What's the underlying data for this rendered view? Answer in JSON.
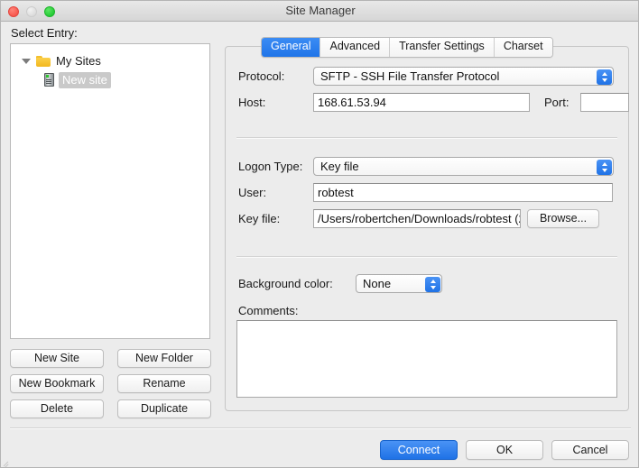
{
  "window": {
    "title": "Site Manager",
    "traffic_lights": [
      "close-button",
      "minimize-button",
      "maximize-button"
    ]
  },
  "sidebar": {
    "label": "Select Entry:",
    "tree": {
      "root": {
        "label": "My Sites",
        "icon": "folder-icon",
        "expanded": true
      },
      "children": [
        {
          "label": "New site",
          "icon": "server-icon",
          "selected": true
        }
      ]
    },
    "buttons": [
      {
        "label": "New Site",
        "name": "new-site-button"
      },
      {
        "label": "New Folder",
        "name": "new-folder-button"
      },
      {
        "label": "New Bookmark",
        "name": "new-bookmark-button"
      },
      {
        "label": "Rename",
        "name": "rename-button"
      },
      {
        "label": "Delete",
        "name": "delete-button"
      },
      {
        "label": "Duplicate",
        "name": "duplicate-button"
      }
    ]
  },
  "tabs": [
    {
      "label": "General",
      "active": true
    },
    {
      "label": "Advanced",
      "active": false
    },
    {
      "label": "Transfer Settings",
      "active": false
    },
    {
      "label": "Charset",
      "active": false
    }
  ],
  "general": {
    "protocol": {
      "label": "Protocol:",
      "value": "SFTP - SSH File Transfer Protocol"
    },
    "host": {
      "label": "Host:",
      "value": "168.61.53.94"
    },
    "port": {
      "label": "Port:",
      "value": ""
    },
    "logon_type": {
      "label": "Logon Type:",
      "value": "Key file"
    },
    "user": {
      "label": "User:",
      "value": "robtest"
    },
    "key_file": {
      "label": "Key file:",
      "value": "/Users/robertchen/Downloads/robtest (2",
      "browse_label": "Browse..."
    },
    "background_color": {
      "label": "Background color:",
      "value": "None"
    },
    "comments": {
      "label": "Comments:",
      "value": ""
    }
  },
  "footer": {
    "connect_label": "Connect",
    "ok_label": "OK",
    "cancel_label": "Cancel"
  },
  "colors": {
    "accent_blue": "#1f72e6",
    "window_bg": "#ececec",
    "selection_gray": "#c9c9c9"
  }
}
